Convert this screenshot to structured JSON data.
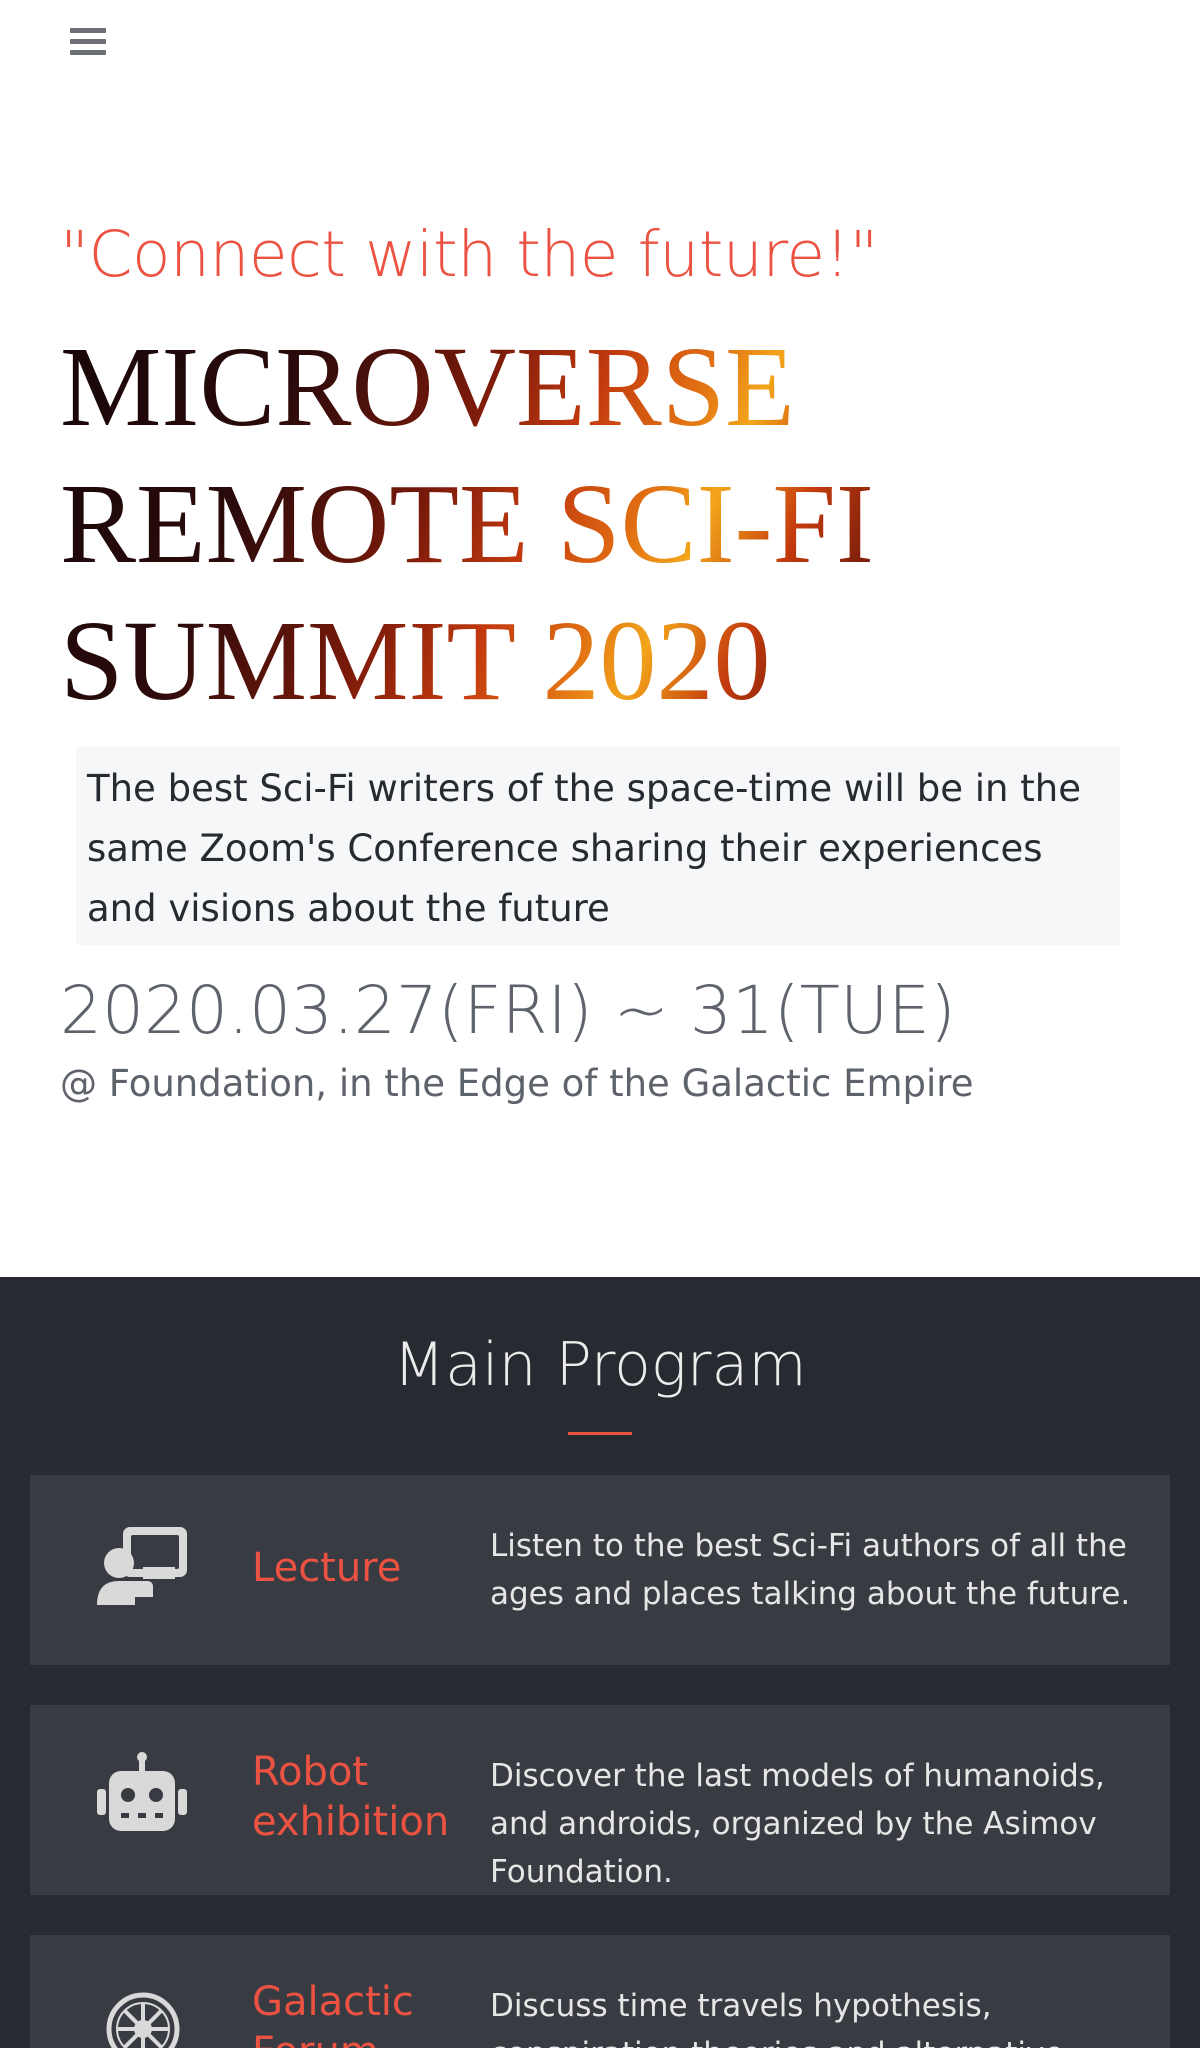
{
  "hero": {
    "tagline": "\"Connect with the future!\"",
    "title_lines": [
      "MICROVERSE",
      "REMOTE SCI-FI",
      "SUMMIT 2020"
    ],
    "intro": "The best Sci-Fi writers of the space-time will be in the same Zoom's Conference sharing their experiences and visions about the future",
    "dates": "2020.03.27(FRI) ~ 31(TUE)",
    "venue": "@ Foundation, in the Edge of the Galactic Empire"
  },
  "program": {
    "title": "Main Program",
    "items": [
      {
        "name": "Lecture",
        "description": "Listen to the best Sci-Fi authors of all the ages and places talking about the future.",
        "icon": "presentation-icon"
      },
      {
        "name": "Robot exhibition",
        "description": "Discover the last models of humanoids, and androids, organized by the Asimov Foundation.",
        "icon": "robot-icon"
      },
      {
        "name": "Galactic Forum",
        "description": "Discuss time travels hypothesis, conspiration theories and alternative universes.",
        "icon": "galactic-republic-icon"
      }
    ]
  },
  "colors": {
    "accent": "#ec5242",
    "dark_bg": "#272a31",
    "card_bg": "#393b42",
    "muted_text": "#5d626b"
  }
}
